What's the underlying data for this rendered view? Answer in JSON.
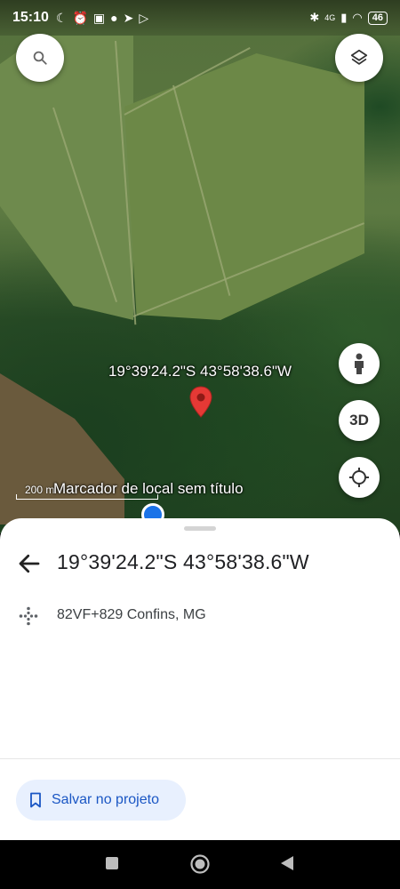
{
  "status_bar": {
    "time": "15:10",
    "network": "4G",
    "battery": "46"
  },
  "map": {
    "coordinates_label": "19°39'24.2\"S 43°58'38.6\"W",
    "marker_label": "Marcador de local sem título",
    "scale_label": "200 m",
    "buttons": {
      "search_icon": "search-icon",
      "layers_icon": "layers-icon",
      "pegman_icon": "pegman-icon",
      "three_d_label": "3D",
      "locate_icon": "crosshair-icon"
    }
  },
  "sheet": {
    "title": "19°39'24.2\"S 43°58'38.6\"W",
    "plus_code": "82VF+829 Confins, MG",
    "save_label": "Salvar no projeto"
  },
  "colors": {
    "accent": "#1a73e8",
    "pin": "#e53935",
    "save_bg": "#e8f0fe",
    "save_text": "#1a56c4"
  }
}
